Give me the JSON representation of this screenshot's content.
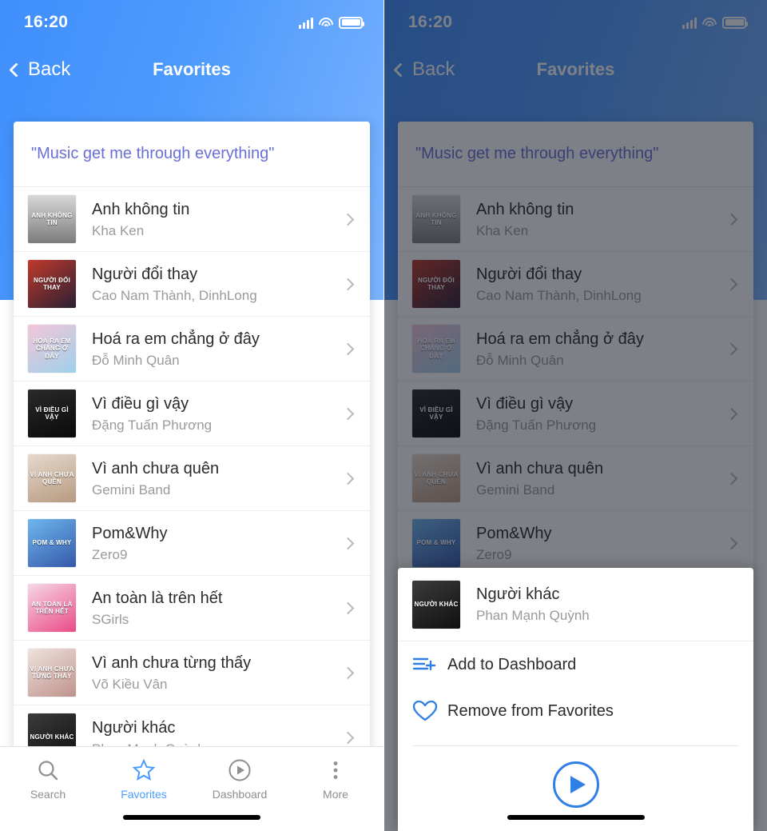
{
  "status": {
    "time": "16:20"
  },
  "nav": {
    "back_label": "Back",
    "title": "Favorites"
  },
  "quote": "\"Music get me through everything\"",
  "songs": [
    {
      "title": "Anh không tin",
      "artist": "Kha Ken",
      "art_text": "ANH KHÔNG TIN",
      "art_bg": "linear-gradient(180deg,#d8d8d8,#7c7c7c)"
    },
    {
      "title": "Người đổi thay",
      "artist": "Cao Nam Thành, DinhLong",
      "art_text": "NGƯỜI ĐỔI THAY",
      "art_bg": "linear-gradient(145deg,#c0392b,#2b2033)"
    },
    {
      "title": "Hoá ra em chẳng ở đây",
      "artist": "Đỗ Minh Quân",
      "art_text": "HOÁ RA EM CHẲNG Ở ĐÂY",
      "art_bg": "linear-gradient(150deg,#f3c6d8,#9ed0ea)"
    },
    {
      "title": "Vì điều gì vậy",
      "artist": "Đặng Tuấn Phương",
      "art_text": "VÌ ĐIỀU GÌ VẬY",
      "art_bg": "linear-gradient(160deg,#2a2a2a,#0a0a0a)"
    },
    {
      "title": "Vì anh chưa quên",
      "artist": "Gemini Band",
      "art_text": "VÌ ANH CHƯA QUÊN",
      "art_bg": "linear-gradient(160deg,#e6d9cd,#b79a80)"
    },
    {
      "title": "Pom&Why",
      "artist": "Zero9",
      "art_text": "POM & WHY",
      "art_bg": "linear-gradient(150deg,#6fb7ef,#3558a8)"
    },
    {
      "title": "An toàn là trên hết",
      "artist": "SGirls",
      "art_text": "AN TOÀN LÀ TRÊN HẾT",
      "art_bg": "linear-gradient(150deg,#f6d7e6,#e94b86)"
    },
    {
      "title": "Vì anh chưa từng thấy",
      "artist": "Võ Kiều Vân",
      "art_text": "VÌ ANH CHƯA TỪNG THẤY",
      "art_bg": "linear-gradient(150deg,#efe3dd,#c0928c)"
    },
    {
      "title": "Người khác",
      "artist": "Phan Mạnh Quỳnh",
      "art_text": "NGƯỜI KHÁC",
      "art_bg": "linear-gradient(150deg,#3b3b3b,#101010)"
    }
  ],
  "tabs": [
    {
      "label": "Search",
      "icon": "search-icon",
      "active": false
    },
    {
      "label": "Favorites",
      "icon": "star-icon",
      "active": true
    },
    {
      "label": "Dashboard",
      "icon": "play-circle-icon",
      "active": false
    },
    {
      "label": "More",
      "icon": "more-dots-icon",
      "active": false
    }
  ],
  "sheet": {
    "song": {
      "title": "Người khác",
      "artist": "Phan Mạnh Quỳnh",
      "art_text": "NGƯỜI KHÁC",
      "art_bg": "linear-gradient(150deg,#3b3b3b,#101010)"
    },
    "actions": [
      {
        "label": "Add to Dashboard",
        "icon": "add-to-list-icon"
      },
      {
        "label": "Remove from Favorites",
        "icon": "heart-icon"
      }
    ],
    "play_label": "Play"
  },
  "colors": {
    "accent": "#4a9bff",
    "quote": "#6a6fd8",
    "play": "#2f7fe6"
  }
}
